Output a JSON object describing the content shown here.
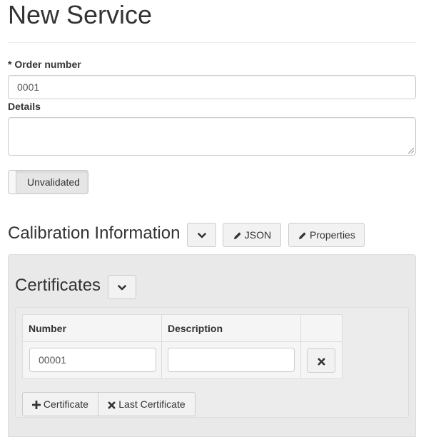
{
  "page": {
    "title": "New Service"
  },
  "form": {
    "order_number": {
      "required_marker": "*",
      "label": "Order number",
      "value": "0001"
    },
    "details": {
      "label": "Details",
      "value": ""
    },
    "validation_toggle": {
      "label": "Unvalidated"
    }
  },
  "calibration": {
    "title": "Calibration Information",
    "json_button": "JSON",
    "properties_button": "Properties"
  },
  "certificates": {
    "title": "Certificates",
    "columns": [
      "Number",
      "Description",
      ""
    ],
    "rows": [
      {
        "number": "00001",
        "description": ""
      }
    ],
    "add_button": "Certificate",
    "last_button": "Last Certificate"
  }
}
